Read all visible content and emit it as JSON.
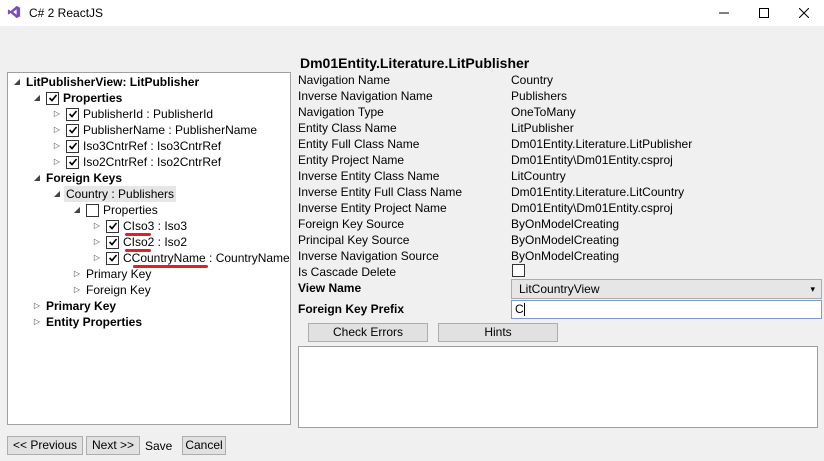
{
  "window": {
    "title": "C# 2 ReactJS",
    "icons": {
      "app": "visual-studio-icon",
      "minimize": "minimize-icon",
      "maximize": "maximize-icon",
      "close": "close-icon"
    }
  },
  "heading": "Dm01Entity.Literature.LitPublisher",
  "tree": {
    "root": "LitPublisherView: LitPublisher",
    "properties": "Properties",
    "property_items": [
      "PublisherId : PublisherId",
      "PublisherName : PublisherName",
      "Iso3CntrRef : Iso3CntrRef",
      "Iso2CntrRef : Iso2CntrRef"
    ],
    "foreign_keys": "Foreign Keys",
    "fk_node": "Country : Publishers",
    "fk_properties": "Properties",
    "fk_property_items": [
      "CIso3 : Iso3",
      "CIso2 : Iso2",
      "CCountryName : CountryName"
    ],
    "fk_primary_key": "Primary Key",
    "fk_foreign_key": "Foreign Key",
    "primary_key": "Primary Key",
    "entity_properties": "Entity Properties"
  },
  "details": [
    {
      "label": "Navigation Name",
      "value": "Country"
    },
    {
      "label": "Inverse Navigation Name",
      "value": "Publishers"
    },
    {
      "label": "Navigation Type",
      "value": "OneToMany"
    },
    {
      "label": "Entity Class Name",
      "value": "LitPublisher"
    },
    {
      "label": "Entity Full Class Name",
      "value": "Dm01Entity.Literature.LitPublisher"
    },
    {
      "label": "Entity Project Name",
      "value": "Dm01Entity\\Dm01Entity.csproj"
    },
    {
      "label": "Inverse Entity Class Name",
      "value": "LitCountry"
    },
    {
      "label": "Inverse Entity Full Class Name",
      "value": "Dm01Entity.Literature.LitCountry"
    },
    {
      "label": "Inverse Entity Project Name",
      "value": "Dm01Entity\\Dm01Entity.csproj"
    },
    {
      "label": "Foreign Key Source",
      "value": "ByOnModelCreating"
    },
    {
      "label": "Principal Key Source",
      "value": "ByOnModelCreating"
    },
    {
      "label": "Inverse Navigation Source",
      "value": "ByOnModelCreating"
    }
  ],
  "form": {
    "cascade_label": "Is Cascade Delete",
    "view_name_label": "View Name",
    "view_name_value": "LitCountryView",
    "fk_prefix_label": "Foreign Key Prefix",
    "fk_prefix_value": "C"
  },
  "buttons": {
    "check_errors": "Check Errors",
    "hints": "Hints",
    "previous": "<< Previous",
    "next": "Next >>",
    "save": "Save",
    "cancel": "Cancel"
  },
  "colors": {
    "underline": "#e0202a",
    "tree_selection": "#e6e6e6"
  }
}
